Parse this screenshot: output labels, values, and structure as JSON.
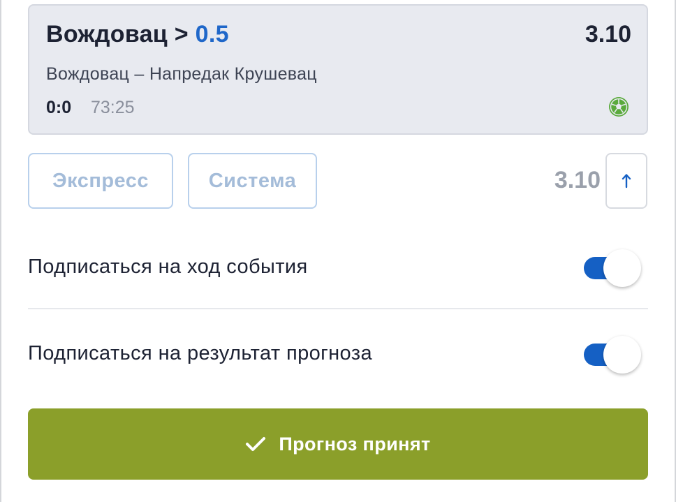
{
  "bet": {
    "outcome_name": "Вождовац >",
    "outcome_line": "0.5",
    "odd": "3.10",
    "match": "Вождовац – Напредак Крушевац",
    "score": "0:0",
    "time": "73:25",
    "sport_icon": "soccer-ball-icon"
  },
  "bet_type": {
    "express_label": "Экспресс",
    "system_label": "Система"
  },
  "total_odd": "3.10",
  "odd_trend_icon": "arrow-up-icon",
  "subscriptions": [
    {
      "label": "Подписаться на ход события",
      "enabled": true
    },
    {
      "label": "Подписаться на результат прогноза",
      "enabled": true
    }
  ],
  "confirm": {
    "label": "Прогноз принят",
    "icon": "check-icon"
  },
  "colors": {
    "accent_blue": "#1f67c9",
    "toggle_on": "#1560c4",
    "confirm_green": "#8b9f2a",
    "sport_icon_green": "#5aaa3c"
  }
}
